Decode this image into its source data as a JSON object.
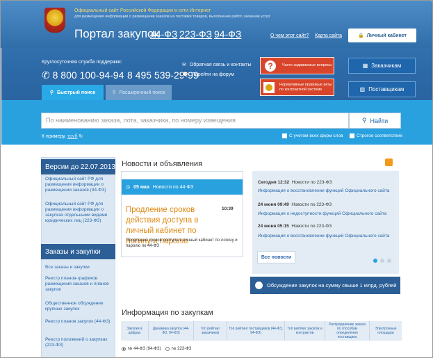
{
  "header": {
    "site_title": "Официальный сайт Российской Федерации в сети Интернет",
    "site_subtitle": "для размещения информации о размещении заказов на поставки товаров, выполнение работ, оказание услуг",
    "portal_title": "Портал закупок",
    "law_links": [
      "44-ФЗ",
      "223-ФЗ",
      "94-ФЗ"
    ],
    "about_link": "О чем этот сайт?",
    "sitemap_link": "Карта сайта",
    "cabinet_label": "Личный кабинет"
  },
  "support": {
    "title": "Круглосуточная служба поддержки:",
    "phone1": "8 800 100-94-94",
    "phone2": "8 495 539-29-99",
    "feedback": "Обратная связь и контакты",
    "forum": "Перейти на форум"
  },
  "buttons": {
    "faq": "Часто задаваемые вопросы",
    "legal": "Нормативные правовые акты по контрактной системе",
    "customers": "Заказчикам",
    "suppliers": "Поставщикам"
  },
  "search": {
    "tab_quick": "Быстрый поиск",
    "tab_advanced": "Расширенный поиск",
    "placeholder": "По наименованию заказа, лота, заказчика, по номеру извещения",
    "button": "Найти",
    "example_label": "К примеру,",
    "example_value": "труб",
    "all_forms": "С учетом всех форм слов",
    "strict": "Строгое соответствие"
  },
  "sidebar": {
    "versions_title": "Версии до 22.07.2013",
    "versions_links": [
      "Официальный сайт РФ для размещения информации о размещении заказов (94-ФЗ)",
      "Официальный сайт РФ для размещения информации о закупках отдельными видами юридических лиц (223-ФЗ)"
    ],
    "orders_title": "Заказы и закупки",
    "orders_links": [
      "Все заказы и закупки",
      "Реестр планов-графиков размещения заказов и планов закупок",
      "Общественное обсуждение крупных закупок",
      "Реестр планов закупок (44-ФЗ)",
      "Реестр положений о закупках (223-ФЗ)"
    ]
  },
  "news": {
    "title": "Новости и объявления",
    "card_date": "05 мая",
    "card_category": "Новости по 44-ФЗ",
    "card_title": "Продление сроков действия доступа в личный кабинет по логину и паролю",
    "card_time": "10:39",
    "card_desc": "Продление сроков доступа в личный кабинет по логину и паролю по 44-ФЗ",
    "list": [
      {
        "date": "Сегодня 12:32",
        "category": "Новости по 223-ФЗ",
        "text": "Информация о восстановлении функций Официального сайта"
      },
      {
        "date": "24 июня 09:49",
        "category": "Новости по 223-ФЗ",
        "text": "Информация о недоступности функций Официального сайта"
      },
      {
        "date": "24 июня 05:15",
        "category": "Новости по 223-ФЗ",
        "text": "Информация о восстановлении функций Официального сайта"
      }
    ],
    "all_news": "Все новости",
    "discuss": "Обсуждение закупок на сумму свыше 1 млрд. рублей"
  },
  "info": {
    "title": "Информация по закупкам",
    "tabs": [
      "Закупки в цифрах",
      "Динамика закупок (44-ФЗ, 94-ФЗ)",
      "Топ рейтинг заказчиков",
      "Топ рейтинг поставщиков (44-ФЗ, 94-ФЗ)",
      "Топ рейтинг закупок и контрактов",
      "Распределение заказа по способам определения поставщика",
      "Электронные площадки"
    ],
    "radio1": "№ 44-ФЗ (94-ФЗ)",
    "radio2": "№ 223-ФЗ"
  },
  "colors": {
    "header_blue": "#2d6aa8",
    "search_blue": "#2aa1df",
    "news_orange": "#e08a12",
    "red_button": "#d9452b"
  }
}
